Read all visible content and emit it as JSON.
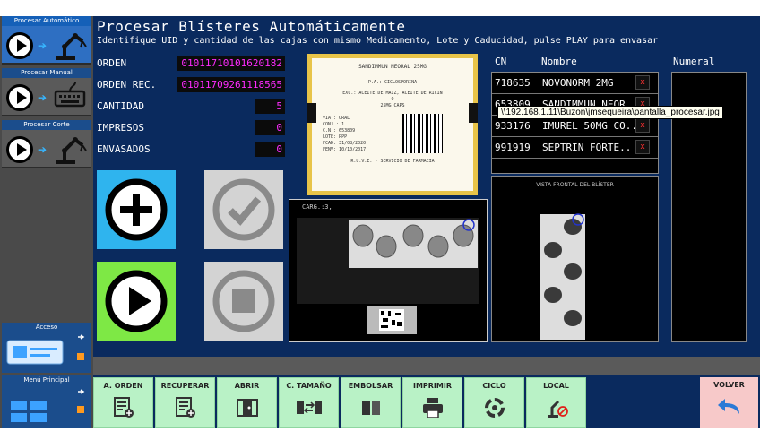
{
  "header": {
    "title": "Procesar Blísteres Automáticamente",
    "subtitle": "Identifique UID y cantidad de las cajas con mismo Medicamento, Lote y Caducidad, pulse PLAY para  envasar"
  },
  "sidebar": {
    "modes": [
      {
        "label": "Procesar Automático"
      },
      {
        "label": "Procesar Manual"
      },
      {
        "label": "Procesar Corte"
      }
    ],
    "acceso": "Acceso",
    "menu_principal": "Menú Principal"
  },
  "fields": {
    "orden_label": "ORDEN",
    "orden_value": "01011710101620182",
    "orden_rec_label": "ORDEN REC.",
    "orden_rec_value": "01011709261118565",
    "cantidad_label": "CANTIDAD",
    "cantidad_value": "5",
    "impresos_label": "IMPRESOS",
    "impresos_value": "0",
    "envasados_label": "ENVASADOS",
    "envasados_value": "0"
  },
  "drug_label": {
    "line1": "SANDIMMUN NEORAL 25MG",
    "line2": "P.A.: CICLOSPORINA",
    "line3": "EXC.: ACEITE DE MAIZ, ACEITE DE RICIN",
    "line4": "O",
    "line5": "25MG CAPS",
    "via": "VIA :  ORAL",
    "conj": "CONJ.: 1",
    "cn": "C.N.:  653809",
    "lote": "LOTE:  PPP",
    "fcad": "FCAD:  31/08/2020",
    "fenv": "FENV:  10/10/2017",
    "footer": "R.U.V.E. - SERVICIO DE FARMACIA"
  },
  "camera": {
    "caption": "CARG.:3,"
  },
  "table": {
    "col_cn": "CN",
    "col_nombre": "Nombre",
    "col_numeral": "Numeral",
    "rows": [
      {
        "cn": "718635",
        "nombre": "NOVONORM 2MG"
      },
      {
        "cn": "653809",
        "nombre": "SANDIMMUN NEOR"
      },
      {
        "cn": "933176",
        "nombre": "IMUREL 50MG CO.."
      },
      {
        "cn": "991919",
        "nombre": "SEPTRIN FORTE.."
      }
    ],
    "delete_glyph": "x"
  },
  "frontal": {
    "caption": "VISTA FRONTAL DEL BLÍSTER"
  },
  "tooltip": "\\\\192.168.1.11\\Buzon\\jmsequeira\\pantalla_procesar.jpg",
  "toolbar": {
    "a_orden": "A. ORDEN",
    "recuperar": "RECUPERAR",
    "abrir": "ABRIR",
    "c_tamano": "C. TAMAÑO",
    "embolsar": "EMBOLSAR",
    "imprimir": "IMPRIMIR",
    "ciclo": "CICLO",
    "local": "LOCAL",
    "volver": "VOLVER"
  },
  "colors": {
    "screen_bg": "#0a2a5e",
    "value_text": "#ff2bff",
    "add_btn": "#2fb4ee",
    "play_btn": "#7ee845",
    "toolbar_btn": "#b9f2c6",
    "volver_btn": "#f7c9c9",
    "label_border": "#e8c449"
  }
}
